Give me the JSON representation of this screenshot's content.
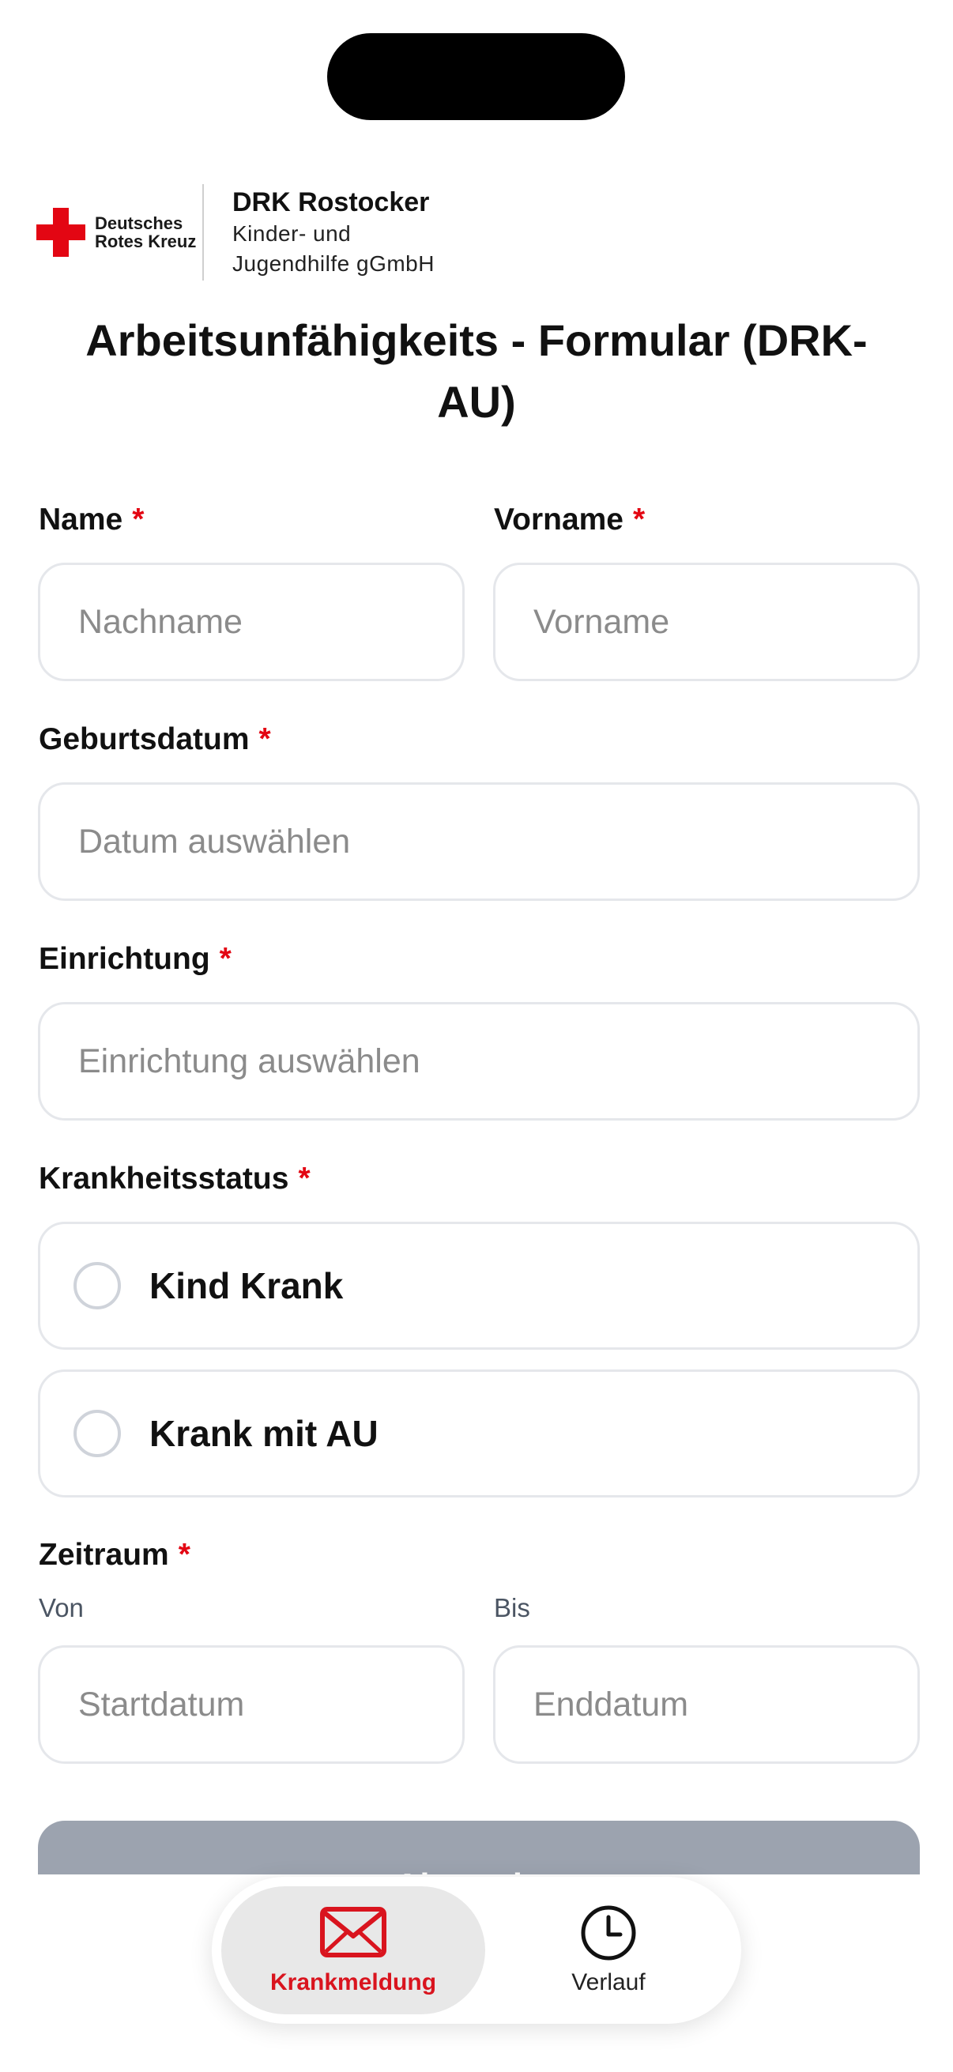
{
  "header": {
    "logo_text": "Deutsches Rotes Kreuz",
    "org_name": "DRK Rostocker",
    "org_sub_1": "Kinder- und",
    "org_sub_2": "Jugendhilfe gGmbH"
  },
  "title": "Arbeitsunfähigkeits - Formular (DRK-AU)",
  "required_marker": "*",
  "form": {
    "name": {
      "label": "Name",
      "placeholder": "Nachname",
      "value": ""
    },
    "vorname": {
      "label": "Vorname",
      "placeholder": "Vorname",
      "value": ""
    },
    "geburtsdatum": {
      "label": "Geburtsdatum",
      "placeholder": "Datum auswählen",
      "value": ""
    },
    "einrichtung": {
      "label": "Einrichtung",
      "placeholder": "Einrichtung auswählen",
      "value": ""
    },
    "krankheitsstatus": {
      "label": "Krankheitsstatus",
      "options": [
        {
          "label": "Kind Krank",
          "selected": false
        },
        {
          "label": "Krank mit AU",
          "selected": false
        }
      ]
    },
    "zeitraum": {
      "label": "Zeitraum",
      "von_label": "Von",
      "von_placeholder": "Startdatum",
      "bis_label": "Bis",
      "bis_placeholder": "Enddatum"
    },
    "submit_label": "Absenden"
  },
  "tabbar": {
    "items": [
      {
        "label": "Krankmeldung",
        "icon": "mail-icon",
        "active": true
      },
      {
        "label": "Verlauf",
        "icon": "clock-icon",
        "active": false
      }
    ]
  },
  "colors": {
    "accent_red": "#e30613",
    "active_tab_red": "#d9141e",
    "submit_disabled": "#9ca3af",
    "border": "#e5e7eb"
  }
}
